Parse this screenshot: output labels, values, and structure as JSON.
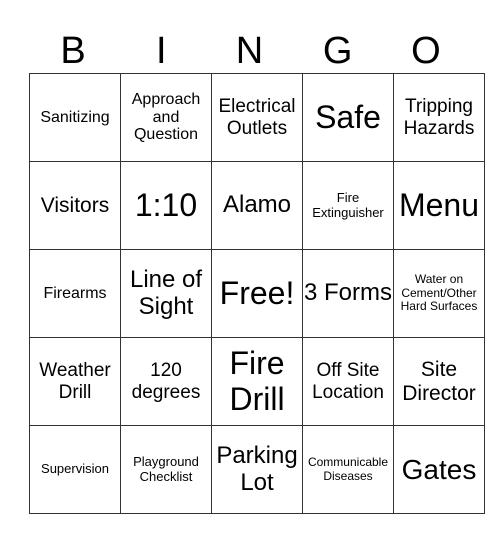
{
  "header": {
    "letters": [
      "B",
      "I",
      "N",
      "G",
      "O"
    ]
  },
  "grid": {
    "rows": [
      [
        "Sanitizing",
        "Approach and Question",
        "Electrical Outlets",
        "Safe",
        "Tripping Hazards"
      ],
      [
        "Visitors",
        "1:10",
        "Alamo",
        "Fire Extinguisher",
        "Menu"
      ],
      [
        "Firearms",
        "Line of Sight",
        "Free!",
        "3 Forms",
        "Water on Cement/Other Hard Surfaces"
      ],
      [
        "Weather Drill",
        "120 degrees",
        "Fire Drill",
        "Off Site Location",
        "Site Director"
      ],
      [
        "Supervision",
        "Playground Checklist",
        "Parking Lot",
        "Communicable Diseases",
        "Gates"
      ]
    ]
  }
}
